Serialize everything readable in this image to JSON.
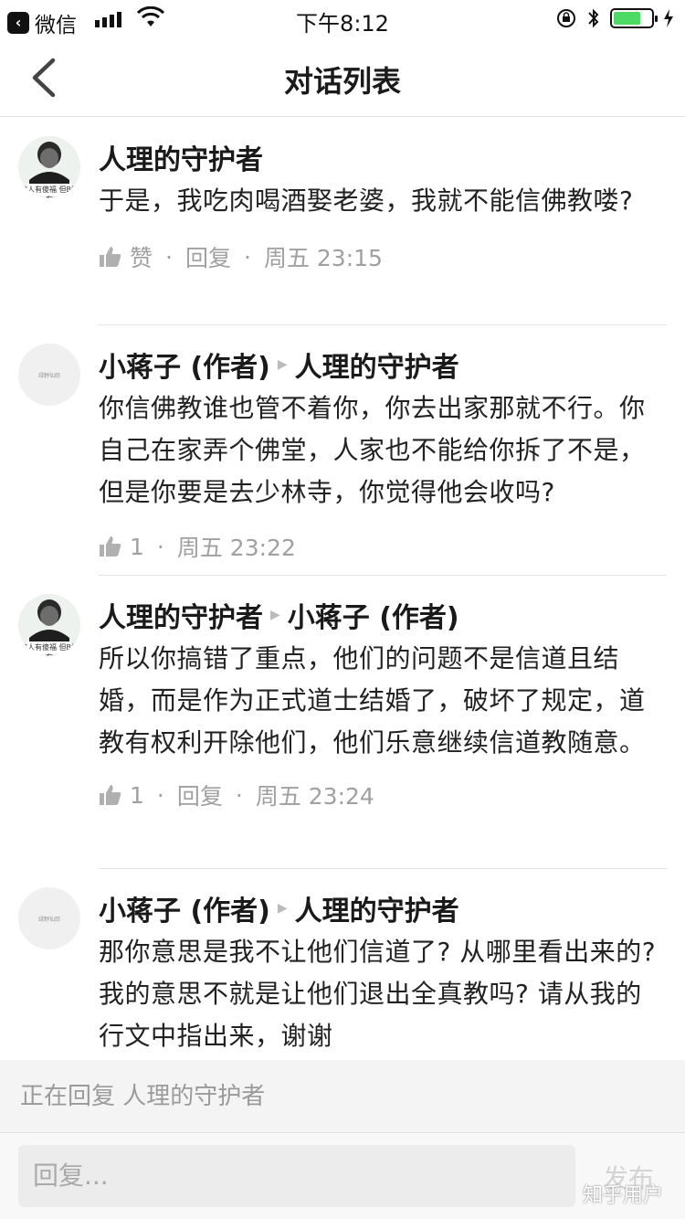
{
  "status_bar": {
    "back_app_label": "微信",
    "time": "下午8:12"
  },
  "nav": {
    "title": "对话列表"
  },
  "comments": [
    {
      "author": "人理的守护者",
      "reply_to": "",
      "text": "于是，我吃肉喝酒娶老婆，我就不能信佛教喽?",
      "like_label": "赞",
      "reply_label": "回复",
      "time": "周五 23:15",
      "avatar_caption": "傻人有傻福 但B没有"
    },
    {
      "author": "小蒋子 (作者)",
      "reply_to": "人理的守护者",
      "text": "你信佛教谁也管不着你，你去出家那就不行。你自己在家弄个佛堂，人家也不能给你拆了不是，但是你要是去少林寺，你觉得他会收吗?",
      "like_count": "1",
      "time": "周五 23:22",
      "avatar_caption": "绿野仙踪"
    },
    {
      "author": "人理的守护者",
      "reply_to": "小蒋子 (作者)",
      "text": "所以你搞错了重点，他们的问题不是信道且结婚，而是作为正式道士结婚了，破坏了规定，道教有权利开除他们，他们乐意继续信道教随意。",
      "like_count": "1",
      "reply_label": "回复",
      "time": "周五 23:24",
      "avatar_caption": "傻人有傻福 但B没有"
    },
    {
      "author": "小蒋子 (作者)",
      "reply_to": "人理的守护者",
      "text": "那你意思是我不让他们信道了? 从哪里看出来的? 我的意思不就是让他们退出全真教吗? 请从我的行文中指出来，谢谢",
      "avatar_caption": "绿野仙踪"
    }
  ],
  "reply_banner": "正在回复 人理的守护者",
  "input": {
    "placeholder": "回复...",
    "send_label": "发布"
  },
  "watermark": "知乎用户"
}
